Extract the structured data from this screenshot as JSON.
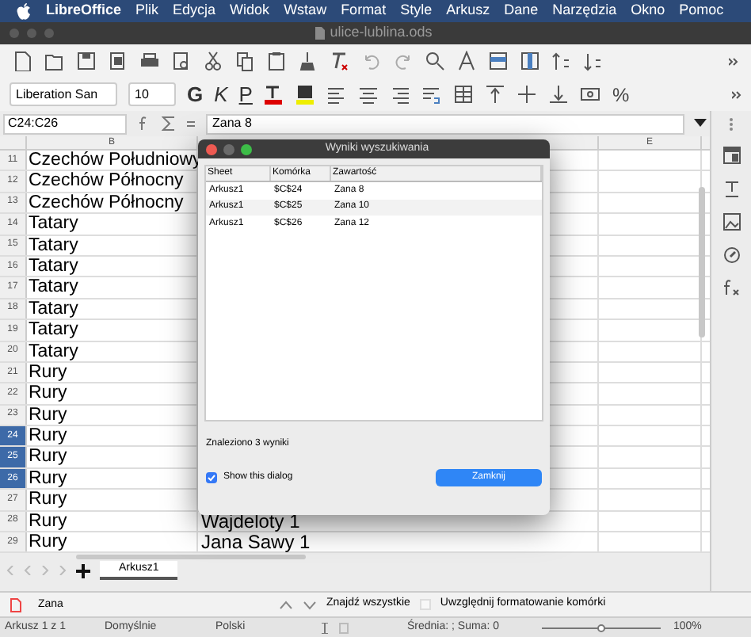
{
  "menubar": {
    "app": "LibreOffice",
    "items": [
      "Plik",
      "Edycja",
      "Widok",
      "Wstaw",
      "Format",
      "Style",
      "Arkusz",
      "Dane",
      "Narzędzia",
      "Okno",
      "Pomoc"
    ]
  },
  "window": {
    "title": "ulice-lublina.ods"
  },
  "toolbar": {
    "font_name": "Liberation San",
    "font_size": "10",
    "bold": "G",
    "italic": "K",
    "underline": "P",
    "percent": "%"
  },
  "formula_bar": {
    "name_box": "C24:C26",
    "content": "Zana 8"
  },
  "sheet": {
    "columns": [
      "B",
      "E"
    ],
    "rows": [
      {
        "number": "11",
        "col_b": "Czechów Południowy",
        "selected": false
      },
      {
        "number": "12",
        "col_b": "Czechów Północny",
        "selected": false
      },
      {
        "number": "13",
        "col_b": "Czechów Północny",
        "selected": false
      },
      {
        "number": "14",
        "col_b": "Tatary",
        "selected": false
      },
      {
        "number": "15",
        "col_b": "Tatary",
        "selected": false
      },
      {
        "number": "16",
        "col_b": "Tatary",
        "selected": false
      },
      {
        "number": "17",
        "col_b": "Tatary",
        "selected": false
      },
      {
        "number": "18",
        "col_b": "Tatary",
        "selected": false
      },
      {
        "number": "19",
        "col_b": "Tatary",
        "selected": false
      },
      {
        "number": "20",
        "col_b": "Tatary",
        "selected": false
      },
      {
        "number": "21",
        "col_b": "Rury",
        "selected": false
      },
      {
        "number": "22",
        "col_b": "Rury",
        "selected": false
      },
      {
        "number": "23",
        "col_b": "Rury",
        "selected": false
      },
      {
        "number": "24",
        "col_b": "Rury",
        "selected": true
      },
      {
        "number": "25",
        "col_b": "Rury",
        "selected": true
      },
      {
        "number": "26",
        "col_b": "Rury",
        "selected": true
      },
      {
        "number": "27",
        "col_b": "Rury",
        "selected": false
      },
      {
        "number": "28",
        "col_b": "Rury",
        "col_c": "Wajdeloty 1",
        "selected": false
      },
      {
        "number": "29",
        "col_b": "Rury",
        "col_c": "Jana Sawy 1",
        "selected": false
      }
    ],
    "tabs": [
      {
        "label": "Arkusz1",
        "selected": true
      }
    ]
  },
  "dialog": {
    "title": "Wyniki wyszukiwania",
    "columns": [
      "Sheet",
      "Komórka",
      "Zawartość"
    ],
    "rows": [
      [
        "Arkusz1",
        "$C$24",
        "Zana 8"
      ],
      [
        "Arkusz1",
        "$C$25",
        "Zana 10"
      ],
      [
        "Arkusz1",
        "$C$26",
        "Zana 12"
      ]
    ],
    "summary": "Znaleziono 3 wyniki",
    "show_dialog": {
      "label": "Show this dialog",
      "checked": true
    },
    "close_button": "Zamknij"
  },
  "find_bar": {
    "value": "Zana",
    "find_all": "Znajdź wszystkie",
    "format_option": {
      "label": "Uwzględnij formatowanie komórki",
      "checked": false
    }
  },
  "status_bar": {
    "sheet": "Arkusz 1 z 1",
    "style": "Domyślnie",
    "language": "Polski",
    "summary": "Średnia: ; Suma: 0",
    "zoom": {
      "level": 0.5
    },
    "zoom_label": "100%"
  }
}
